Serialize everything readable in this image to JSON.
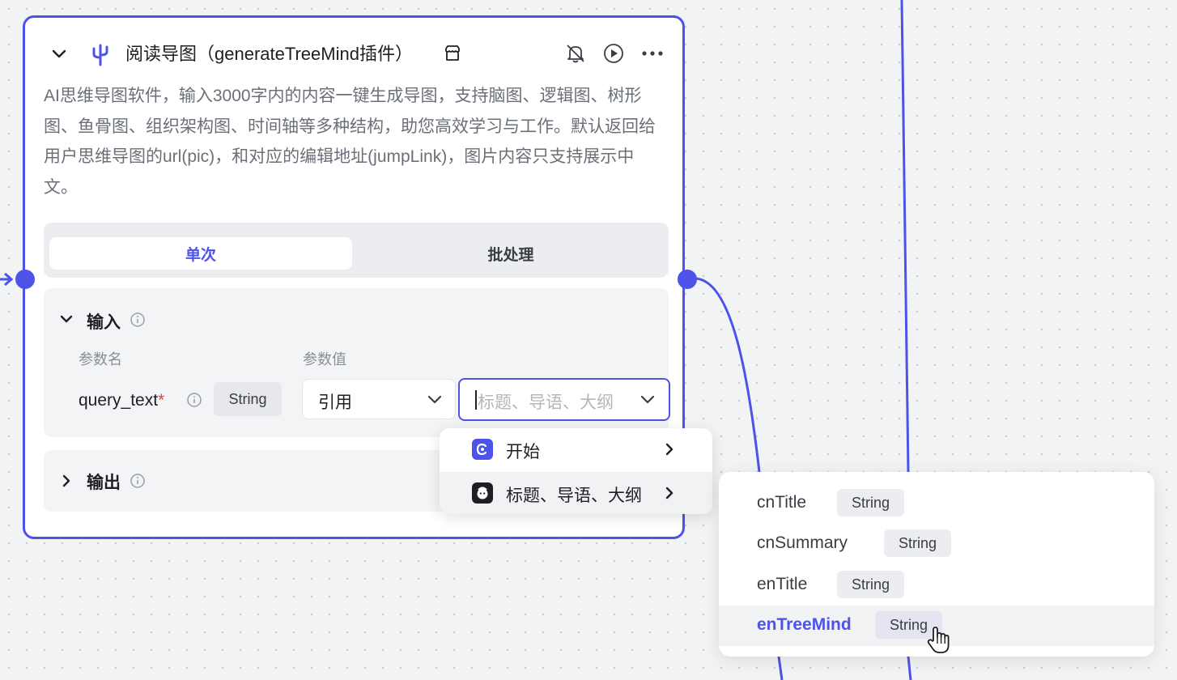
{
  "colors": {
    "accent": "#4d53e8",
    "required": "#e8403d"
  },
  "node": {
    "title": "阅读导图（generateTreeMind插件）",
    "description": "AI思维导图软件，输入3000字内的内容一键生成导图，支持脑图、逻辑图、树形图、鱼骨图、组织架构图、时间轴等多种结构，助您高效学习与工作。默认返回给用户思维导图的url(pic)，和对应的编辑地址(jumpLink)，图片内容只支持展示中文。",
    "icons": [
      "chevron-down-icon",
      "plugin-icon",
      "store-icon",
      "bell-off-icon",
      "play-circle-icon",
      "more-icon"
    ],
    "tabs": {
      "single": "单次",
      "batch": "批处理"
    },
    "input_section": {
      "title": "输入",
      "col_name": "参数名",
      "col_value": "参数值",
      "param_name": "query_text",
      "required_mark": "*",
      "param_type": "String",
      "value_mode": "引用",
      "value_placeholder": "标题、导语、大纲"
    },
    "output_section": {
      "title": "输出"
    }
  },
  "dropdown": {
    "items": [
      {
        "label": "开始",
        "icon": "start-node-icon"
      },
      {
        "label": "标题、导语、大纲",
        "icon": "bot-avatar-icon"
      }
    ]
  },
  "subpanel": {
    "items": [
      {
        "name": "cnTitle",
        "type": "String"
      },
      {
        "name": "cnSummary",
        "type": "String"
      },
      {
        "name": "enTitle",
        "type": "String"
      },
      {
        "name": "enTreeMind",
        "type": "String"
      }
    ]
  }
}
